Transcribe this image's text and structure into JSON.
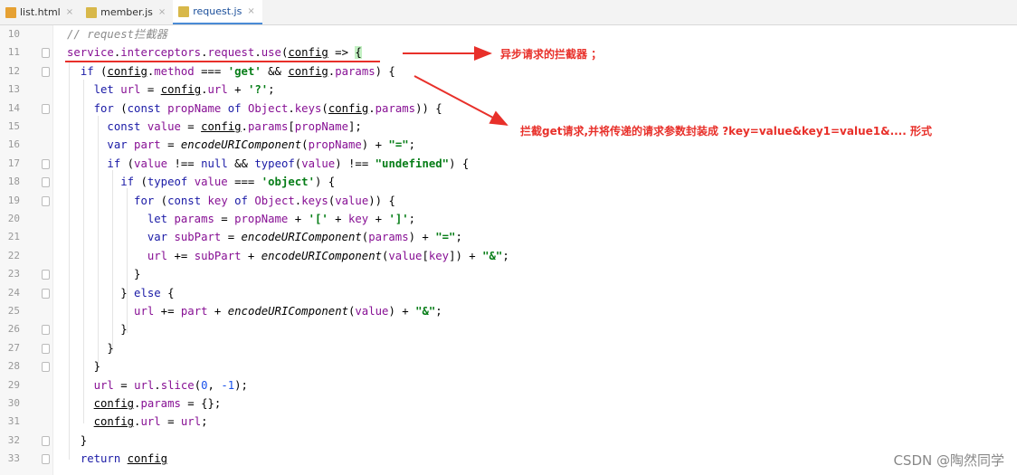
{
  "tabs": [
    {
      "label": "list.html",
      "icon": "html-file-icon"
    },
    {
      "label": "member.js",
      "icon": "js-file-icon"
    },
    {
      "label": "request.js",
      "icon": "js-file-icon",
      "active": true
    }
  ],
  "lines": [
    {
      "n": "10",
      "html": "<span class='cm'>// request拦截器</span>"
    },
    {
      "n": "11",
      "html": "<span class='prop'>service</span>.<span class='prop'>interceptors</span>.<span class='prop'>request</span>.<span class='prop'>use</span>(<span class='u'>config</span> =&gt; <span class='br'>{</span>"
    },
    {
      "n": "12",
      "html": "  <span class='kw'>if</span> (<span class='u'>config</span>.<span class='prop'>method</span> === <span class='str'>'get'</span> &amp;&amp; <span class='u'>config</span>.<span class='prop'>params</span>) {"
    },
    {
      "n": "13",
      "html": "    <span class='kw'>let</span> <span class='prop'>url</span> = <span class='u'>config</span>.<span class='prop'>url</span> + <span class='str'>'?'</span>;"
    },
    {
      "n": "14",
      "html": "    <span class='kw'>for</span> (<span class='kw'>const</span> <span class='prop'>propName</span> <span class='kw'>of</span> <span class='prop'>Object</span>.<span class='prop'>keys</span>(<span class='u'>config</span>.<span class='prop'>params</span>)) {"
    },
    {
      "n": "15",
      "html": "      <span class='kw'>const</span> <span class='prop'>value</span> = <span class='u'>config</span>.<span class='prop'>params</span>[<span class='prop'>propName</span>];"
    },
    {
      "n": "16",
      "html": "      <span class='kw'>var</span> <span class='prop'>part</span> = <span class='fn'>encodeURIComponent</span>(<span class='prop'>propName</span>) + <span class='str'>\"=\"</span>;"
    },
    {
      "n": "17",
      "html": "      <span class='kw'>if</span> (<span class='prop'>value</span> !== <span class='kw'>null</span> &amp;&amp; <span class='kw'>typeof</span>(<span class='prop'>value</span>) !== <span class='str'>\"undefined\"</span>) {"
    },
    {
      "n": "18",
      "html": "        <span class='kw'>if</span> (<span class='kw'>typeof</span> <span class='prop'>value</span> === <span class='str'>'object'</span>) {"
    },
    {
      "n": "19",
      "html": "          <span class='kw'>for</span> (<span class='kw'>const</span> <span class='prop'>key</span> <span class='kw'>of</span> <span class='prop'>Object</span>.<span class='prop'>keys</span>(<span class='prop'>value</span>)) {"
    },
    {
      "n": "20",
      "html": "            <span class='kw'>let</span> <span class='prop'>params</span> = <span class='prop'>propName</span> + <span class='str'>'['</span> + <span class='prop'>key</span> + <span class='str'>']'</span>;"
    },
    {
      "n": "21",
      "html": "            <span class='kw'>var</span> <span class='prop'>subPart</span> = <span class='fn'>encodeURIComponent</span>(<span class='prop'>params</span>) + <span class='str'>\"=\"</span>;"
    },
    {
      "n": "22",
      "html": "            <span class='prop'>url</span> += <span class='prop'>subPart</span> + <span class='fn'>encodeURIComponent</span>(<span class='prop'>value</span>[<span class='prop'>key</span>]) + <span class='str'>\"&amp;\"</span>;"
    },
    {
      "n": "23",
      "html": "          }"
    },
    {
      "n": "24",
      "html": "        } <span class='kw'>else</span> {"
    },
    {
      "n": "25",
      "html": "          <span class='prop'>url</span> += <span class='prop'>part</span> + <span class='fn'>encodeURIComponent</span>(<span class='prop'>value</span>) + <span class='str'>\"&amp;\"</span>;"
    },
    {
      "n": "26",
      "html": "        }"
    },
    {
      "n": "27",
      "html": "      }"
    },
    {
      "n": "28",
      "html": "    }"
    },
    {
      "n": "29",
      "html": "    <span class='prop'>url</span> = <span class='prop'>url</span>.<span class='prop'>slice</span>(<span class='num'>0</span>, <span class='num'>-1</span>);"
    },
    {
      "n": "30",
      "html": "    <span class='u'>config</span>.<span class='prop'>params</span> = {};"
    },
    {
      "n": "31",
      "html": "    <span class='u'>config</span>.<span class='prop'>url</span> = <span class='prop'>url</span>;"
    },
    {
      "n": "32",
      "html": "  }"
    },
    {
      "n": "33",
      "html": "  <span class='kw'>return</span> <span class='u'>config</span>"
    }
  ],
  "annotations": {
    "interceptor_note": "异步请求的拦截器 ；",
    "get_note": "拦截get请求,并将传递的请求参数封装成 ?key=value&key1=value1&.... 形式"
  },
  "watermark": "CSDN @陶然同学"
}
